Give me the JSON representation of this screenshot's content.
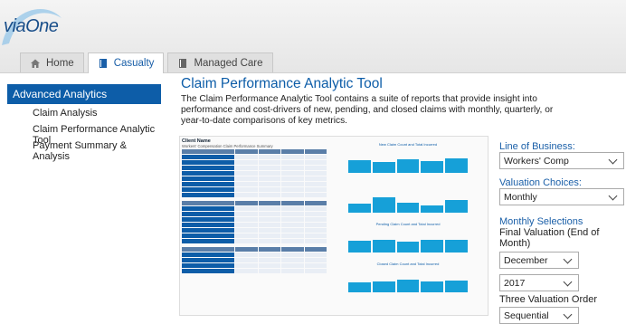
{
  "app": {
    "logo_text": "viaOne"
  },
  "tabs": [
    {
      "label": "Home",
      "icon": "home-icon"
    },
    {
      "label": "Casualty",
      "icon": "book-icon"
    },
    {
      "label": "Managed Care",
      "icon": "book-icon"
    }
  ],
  "sidebar": {
    "heading": "Advanced Analytics",
    "items": [
      {
        "label": "Claim Analysis"
      },
      {
        "label": "Claim Performance Analytic Tool"
      },
      {
        "label": "Payment Summary & Analysis"
      }
    ]
  },
  "main": {
    "title": "Claim Performance Analytic Tool",
    "description": "The Claim Performance Analytic Tool contains a suite of reports that provide insight into performance and cost-drivers of new, pending, and closed claims with monthly, quarterly, or year-to-date comparisons of key metrics."
  },
  "report_preview": {
    "client_name": "Client Name",
    "subtitle": "Workers' Compensation Claim Performance Summary",
    "chart_titles": [
      "New Claim Count and Total Incurred",
      "Pending Claim Count and Total Incurred",
      "Closed Claim Count and Total Incurred"
    ]
  },
  "form": {
    "line_of_business": {
      "label": "Line of Business:",
      "value": "Workers' Comp"
    },
    "valuation_choices": {
      "label": "Valuation Choices:",
      "value": "Monthly"
    },
    "monthly_selections": {
      "label": "Monthly Selections",
      "final_valuation_label": "Final Valuation (End of Month)",
      "month_value": "December",
      "year_value": "2017"
    },
    "three_valuation_order": {
      "label": "Three Valuation Order",
      "value": "Sequential"
    }
  },
  "colors": {
    "accent": "#0d5da8",
    "chart_bar": "#16a0d8"
  }
}
